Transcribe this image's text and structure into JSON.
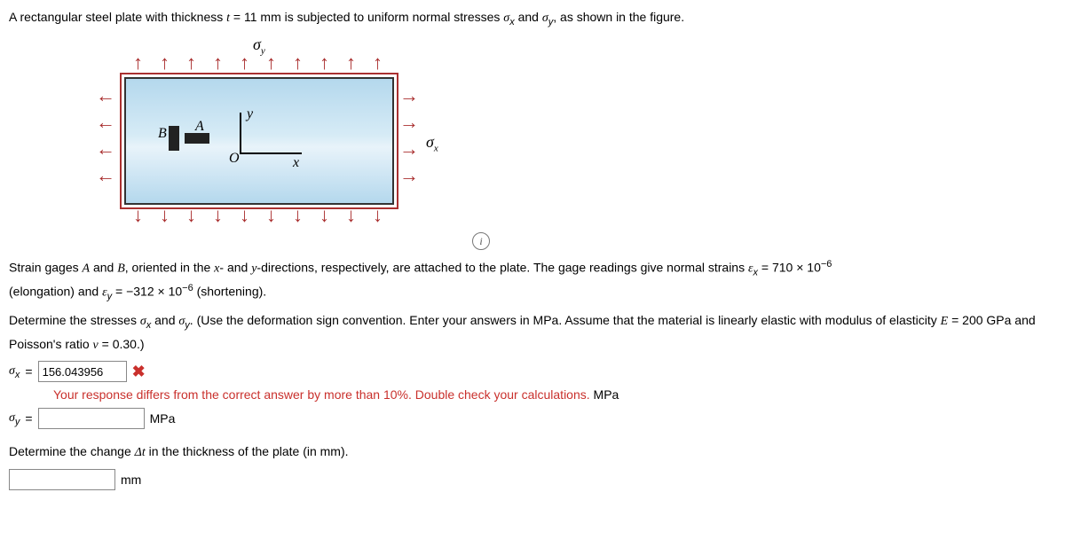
{
  "intro": {
    "prefix": "A rectangular steel plate with thickness ",
    "t_var": "t",
    "eq": " = ",
    "t_val": "11 mm",
    "mid": " is subjected to uniform normal stresses ",
    "sx": "σ",
    "sx_sub": "x",
    "and": " and ",
    "sy": "σ",
    "sy_sub": "y",
    "suffix": ", as shown in the figure."
  },
  "figure": {
    "sigma_y_label": "σ",
    "sigma_y_sub": "y",
    "sigma_x_label": "σ",
    "sigma_x_sub": "x",
    "B": "B",
    "A": "A",
    "O": "O",
    "x": "x",
    "y": "y",
    "info": "i"
  },
  "strain_text": {
    "p1_a": "Strain gages ",
    "A": "A",
    "and1": " and ",
    "B": "B",
    "p1_b": ", oriented in the ",
    "x": "x",
    "dash": "- and ",
    "y": "y",
    "p1_c": "-directions, respectively, are attached to the plate. The gage readings give normal strains ",
    "ex": "ε",
    "ex_sub": "x",
    "eq1": " = ",
    "ex_val": "710 × 10",
    "ex_exp": "−6",
    "p2_a": "(elongation) and ",
    "ey": "ε",
    "ey_sub": "y",
    "eq2": " = ",
    "ey_val": "−312 × 10",
    "ey_exp": "−6",
    "p2_b": " (shortening)."
  },
  "determine1": {
    "a": "Determine the stresses ",
    "sx": "σ",
    "sx_sub": "x",
    "and": " and ",
    "sy": "σ",
    "sy_sub": "y",
    "b": ". (Use the deformation sign convention. Enter your answers in MPa. Assume that the material is linearly elastic with modulus of elasticity ",
    "E": "E",
    "eqE": " = ",
    "Eval": "200 GPa",
    "c": " and Poisson's ratio ",
    "nu": "ν",
    "eqNu": " = ",
    "nuVal": "0.30",
    "d": ".)"
  },
  "answers": {
    "sx_label": "σ",
    "sx_sub": "x",
    "sy_label": "σ",
    "sy_sub": "y",
    "eq": " = ",
    "sx_value": "156.043956",
    "sy_value": "",
    "unit": "MPa",
    "feedback": "Your response differs from the correct answer by more than 10%. Double check your calculations."
  },
  "determine2": {
    "text_a": "Determine the change ",
    "dt": "Δt",
    "text_b": " in the thickness of the plate (in mm).",
    "unit": "mm",
    "value": ""
  }
}
